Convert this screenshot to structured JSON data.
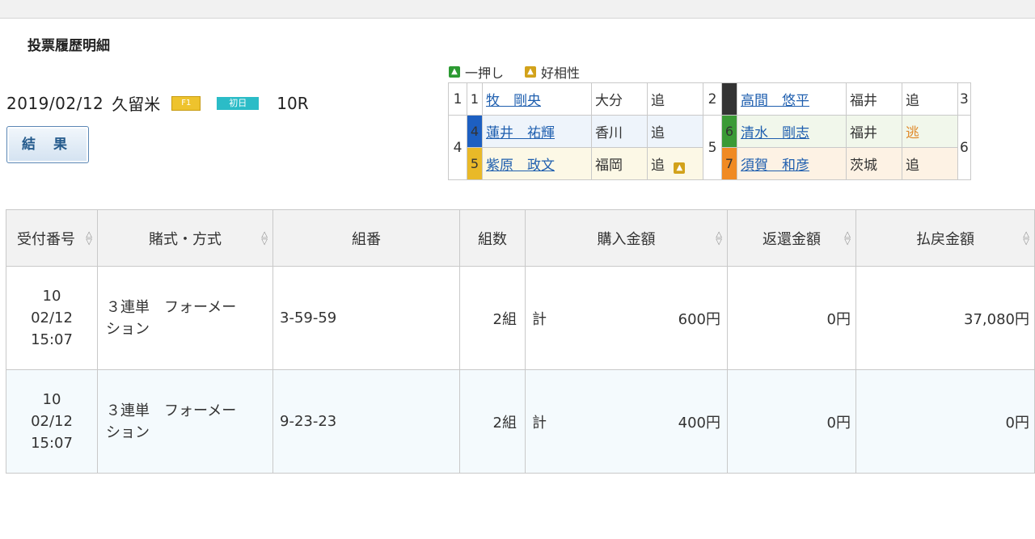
{
  "section_title": "投票履歴明細",
  "legend": {
    "green_label": "一押し",
    "gold_label": "好相性"
  },
  "race": {
    "date": "2019/02/12",
    "venue": "久留米",
    "grade_badge": "F1",
    "day_badge": "初日",
    "race_number": "10R"
  },
  "result_button": "結 果",
  "lineup": {
    "rows": [
      {
        "left": {
          "pos": "1",
          "num": "1",
          "name": "牧　剛央",
          "pref": "大分",
          "style": "追",
          "icon": ""
        },
        "right": {
          "pos": "2",
          "num": "2",
          "name": "高間　悠平",
          "pref": "福井",
          "style": "追"
        },
        "partial": "3"
      },
      {
        "left": {
          "pos": "4",
          "num": "4",
          "name": "蓮井　祐輝",
          "pref": "香川",
          "style": "追",
          "icon": ""
        },
        "right": {
          "pos": "5",
          "num": "6",
          "name": "清水　剛志",
          "pref": "福井",
          "style": "逃"
        },
        "partial": "6"
      },
      {
        "left": {
          "num": "5",
          "name": "紫原　政文",
          "pref": "福岡",
          "style": "追",
          "icon": "gold"
        },
        "right": {
          "num": "7",
          "name": "須賀　和彦",
          "pref": "茨城",
          "style": "追"
        }
      }
    ]
  },
  "bets": {
    "headers": [
      "受付番号",
      "賭式・方式",
      "組番",
      "組数",
      "購入金額",
      "返還金額",
      "払戻金額"
    ],
    "rows": [
      {
        "id": "10",
        "date": "02/12",
        "time": "15:07",
        "type1": "３連単　フォーメー",
        "type2": "ション",
        "combo": "3-59-59",
        "count": "2組",
        "total_label": "計",
        "buy": "600円",
        "refund": "0円",
        "payout": "37,080円"
      },
      {
        "id": "10",
        "date": "02/12",
        "time": "15:07",
        "type1": "３連単　フォーメー",
        "type2": "ション",
        "combo": "9-23-23",
        "count": "2組",
        "total_label": "計",
        "buy": "400円",
        "refund": "0円",
        "payout": "0円"
      }
    ]
  },
  "colors": {
    "accent_link": "#1f5faf",
    "button_border": "#5b87b5",
    "nige": "#e08a2c"
  }
}
